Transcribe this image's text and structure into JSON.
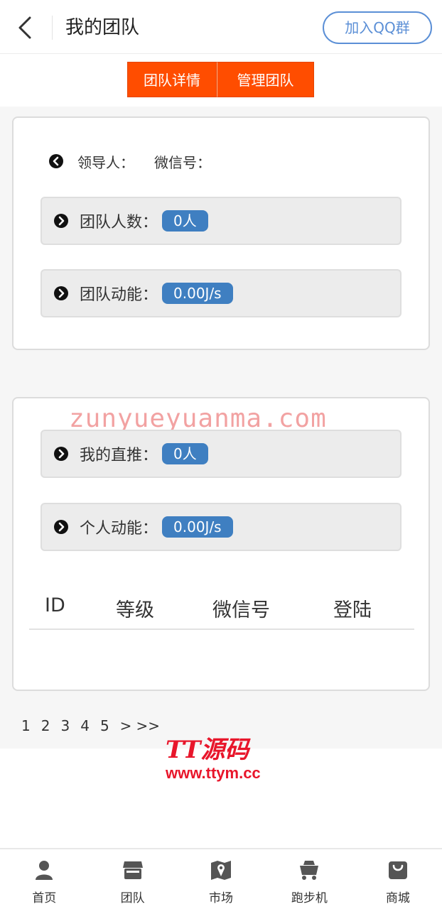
{
  "header": {
    "title": "我的团队",
    "qq_button": "加入QQ群"
  },
  "tabs": [
    {
      "label": "团队详情"
    },
    {
      "label": "管理团队"
    }
  ],
  "team_card": {
    "leader_label": "领导人：",
    "wechat_label": "微信号：",
    "team_size_label": "团队人数：",
    "team_size_value": "0人",
    "team_power_label": "团队动能：",
    "team_power_value": "0.00J/s"
  },
  "personal_card": {
    "watermark": "zunyueyuanma.com",
    "direct_label": "我的直推：",
    "direct_value": "0人",
    "power_label": "个人动能：",
    "power_value": "0.00J/s",
    "table_headers": [
      "ID",
      "等级",
      "微信号",
      "登陆"
    ]
  },
  "pager": {
    "pages": [
      "1",
      "2",
      "3",
      "4",
      "5"
    ],
    "next": ">",
    "last": ">>"
  },
  "brand": {
    "logo_text": "TT源码",
    "url": "www.ttym.cc"
  },
  "tabbar": {
    "items": [
      {
        "label": "首页",
        "icon": "user-icon"
      },
      {
        "label": "团队",
        "icon": "shop-icon"
      },
      {
        "label": "市场",
        "icon": "map-icon"
      },
      {
        "label": "跑步机",
        "icon": "cart-icon"
      },
      {
        "label": "商城",
        "icon": "bag-icon"
      }
    ]
  },
  "colors": {
    "accent": "#ff4d00",
    "badge": "#3f7fc1",
    "qq_border": "#5b8fd6",
    "brand": "#e8162b"
  }
}
